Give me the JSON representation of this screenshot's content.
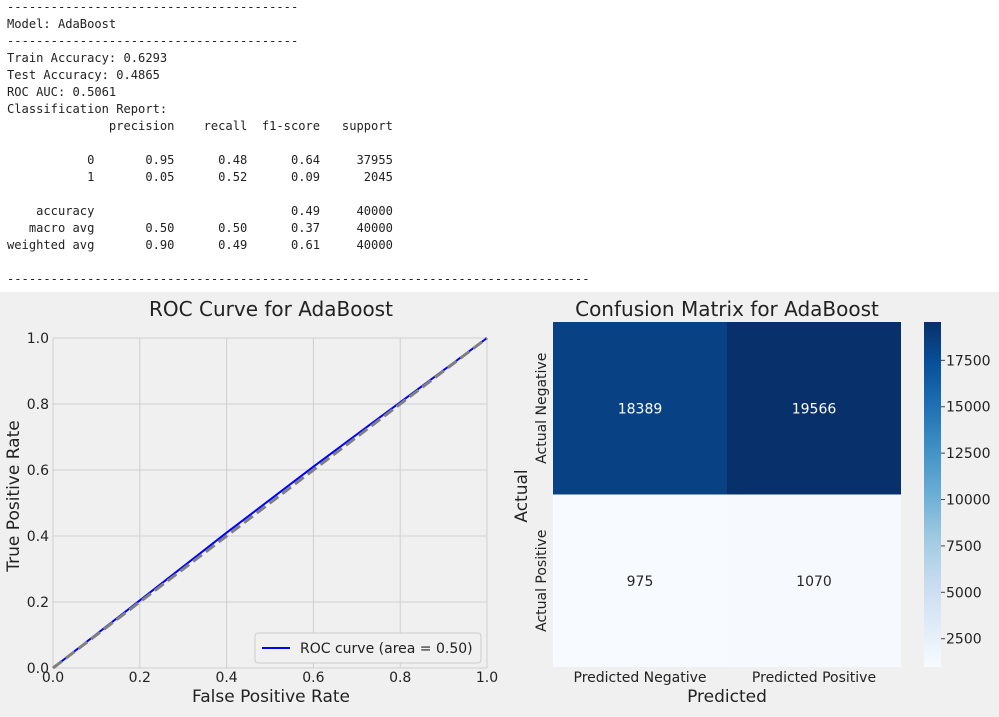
{
  "console": {
    "lines": [
      "----------------------------------------",
      "Model: AdaBoost",
      "----------------------------------------",
      "Train Accuracy: 0.6293",
      "Test Accuracy: 0.4865",
      "ROC AUC: 0.5061",
      "Classification Report:",
      "              precision    recall  f1-score   support",
      "",
      "           0       0.95      0.48      0.64     37955",
      "           1       0.05      0.52      0.09      2045",
      "",
      "    accuracy                           0.49     40000",
      "   macro avg       0.50      0.50      0.37     40000",
      "weighted avg       0.90      0.49      0.61     40000",
      "",
      "--------------------------------------------------------------------------------"
    ]
  },
  "chart_data": [
    {
      "type": "line",
      "title": "ROC Curve for AdaBoost",
      "xlabel": "False Positive Rate",
      "ylabel": "True Positive Rate",
      "xlim": [
        0.0,
        1.0
      ],
      "ylim": [
        0.0,
        1.0
      ],
      "xticks": [
        "0.0",
        "0.2",
        "0.4",
        "0.6",
        "0.8",
        "1.0"
      ],
      "yticks": [
        "0.0",
        "0.2",
        "0.4",
        "0.6",
        "0.8",
        "1.0"
      ],
      "grid": true,
      "legend_position": "lower-right",
      "series": [
        {
          "name": "ROC curve (area = 0.50)",
          "color": "#0000ff",
          "style": "solid",
          "x": [
            0.0,
            0.2,
            0.4,
            0.6,
            0.8,
            1.0
          ],
          "y": [
            0.0,
            0.205,
            0.41,
            0.61,
            0.805,
            1.0
          ]
        },
        {
          "name": "",
          "color": "#808080",
          "style": "dashed",
          "x": [
            0.0,
            1.0
          ],
          "y": [
            0.0,
            1.0
          ]
        }
      ]
    },
    {
      "type": "heatmap",
      "title": "Confusion Matrix for AdaBoost",
      "xlabel": "Predicted",
      "ylabel": "Actual",
      "x_categories": [
        "Predicted Negative",
        "Predicted Positive"
      ],
      "y_categories": [
        "Actual Negative",
        "Actual Positive"
      ],
      "values": [
        [
          18389,
          19566
        ],
        [
          975,
          1070
        ]
      ],
      "colormap": "Blues",
      "colorbar_ticks": [
        2500,
        5000,
        7500,
        10000,
        12500,
        15000,
        17500
      ],
      "colorbar_range": [
        975,
        19566
      ]
    }
  ]
}
